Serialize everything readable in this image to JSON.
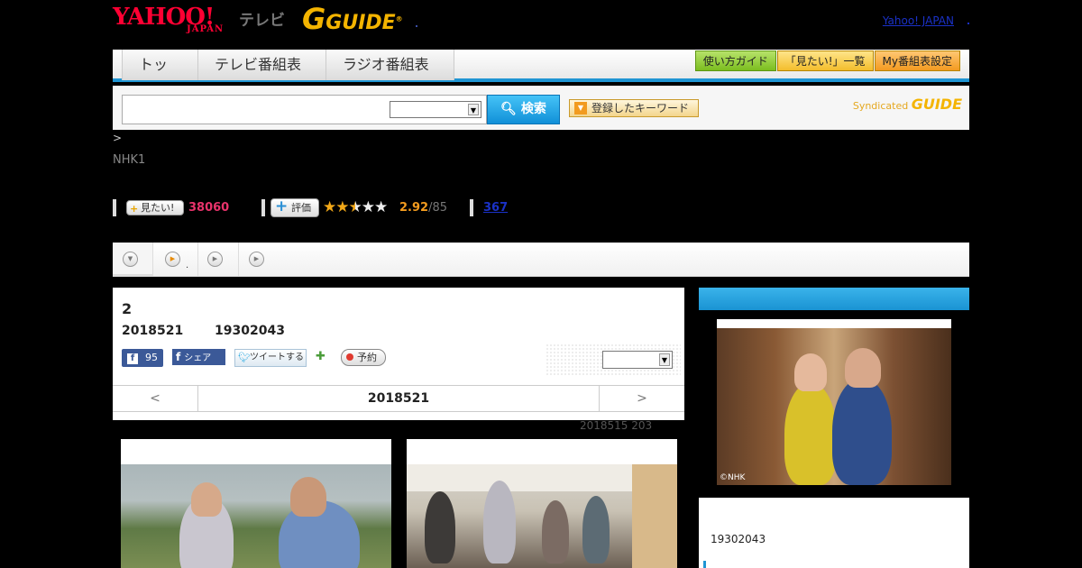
{
  "header": {
    "logo_yahoo": "YAHOO!",
    "logo_japan": "JAPAN",
    "logo_tv": "テレビ",
    "logo_gguide": "GUIDE",
    "logo_gguide_g": "G",
    "yahoo_japan_link": "Yahoo! JAPAN"
  },
  "nav": {
    "tabs": [
      "トップ",
      "テレビ番組表",
      "ラジオ番組表"
    ],
    "buttons": [
      "使い方ガイド",
      "「見たい!」一覧",
      "My番組表設定"
    ]
  },
  "search": {
    "input_value": "",
    "select_value": "",
    "search_button": "検索",
    "keyword_button": "登録したキーワード",
    "syndicated": "Syndicated",
    "syndicated_logo": "GUIDE"
  },
  "breadcrumb": ">",
  "channel": "NHK1",
  "stats": {
    "mitai_label": "見たい!",
    "mitai_count": "38060",
    "rate_label": "評価",
    "stars_filled": 2.5,
    "stars_total": 5,
    "rating": "2.92",
    "rating_max": "/85",
    "reviews": "367"
  },
  "tabstrip": {
    "tab2_label": "."
  },
  "program": {
    "title": "2",
    "date": "2018521",
    "time": "19302043",
    "fb_count": "95",
    "fb_share": "シェア",
    "tweet": "ツイートする",
    "reserve": "予約",
    "select_value": "",
    "day_prev": "<",
    "day_current": "2018521",
    "day_next": ">"
  },
  "update_note": "2018515  203",
  "side": {
    "photo_credit": "©NHK",
    "time": "19302043"
  },
  "colors": {
    "accent": "#1f95d3",
    "mitai": "#e8336b",
    "rating": "#f29b1f"
  }
}
